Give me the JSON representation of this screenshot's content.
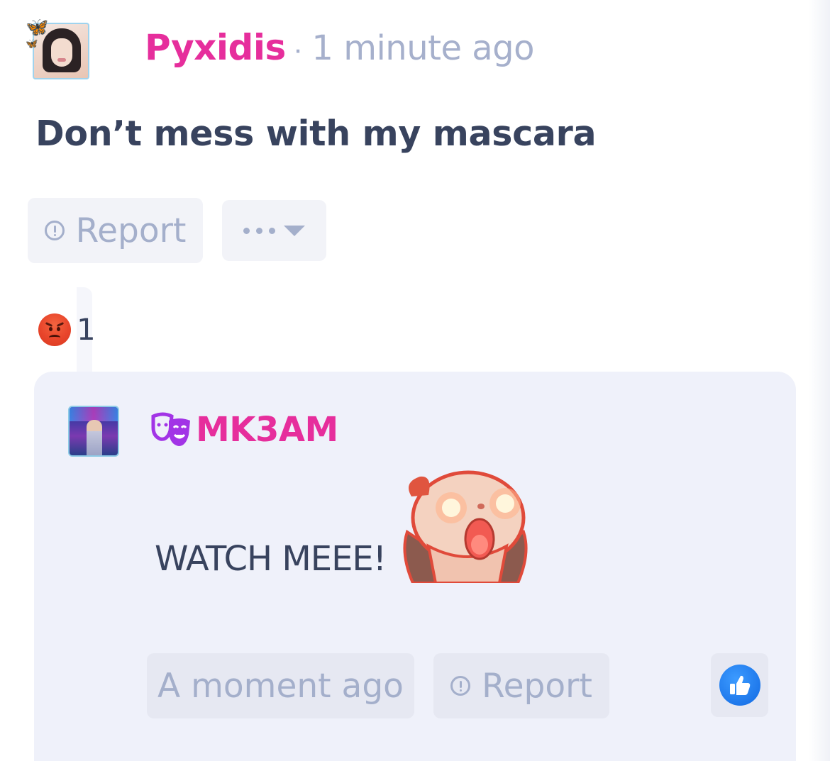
{
  "comment": {
    "username": "Pyxidis",
    "separator": "·",
    "timestamp": "1 minute ago",
    "text": "Don’t mess with my mascara",
    "avatar_icon": "profile-avatar",
    "decoration_icon": "butterfly-icon"
  },
  "actions": {
    "report_label": "Report",
    "report_icon": "info-circle-icon",
    "more_icon": "ellipsis-dropdown-icon"
  },
  "reaction": {
    "emoji": "angry-face-icon",
    "count": "1"
  },
  "reply": {
    "username": "MK3AM",
    "badge_icon": "theater-masks-icon",
    "text": "WATCH MEEE!",
    "sticker": "shocked-creature-sticker",
    "time_label": "A moment ago",
    "report_label": "Report",
    "like_icon": "thumbs-up-icon"
  },
  "colors": {
    "username": "#e62e9c",
    "muted": "#a4afcb",
    "text": "#38435e",
    "reply_bg": "#eff1fa",
    "button_bg": "#f2f3f8",
    "like_blue": "#1a73e8",
    "badge_purple": "#a234e6"
  }
}
